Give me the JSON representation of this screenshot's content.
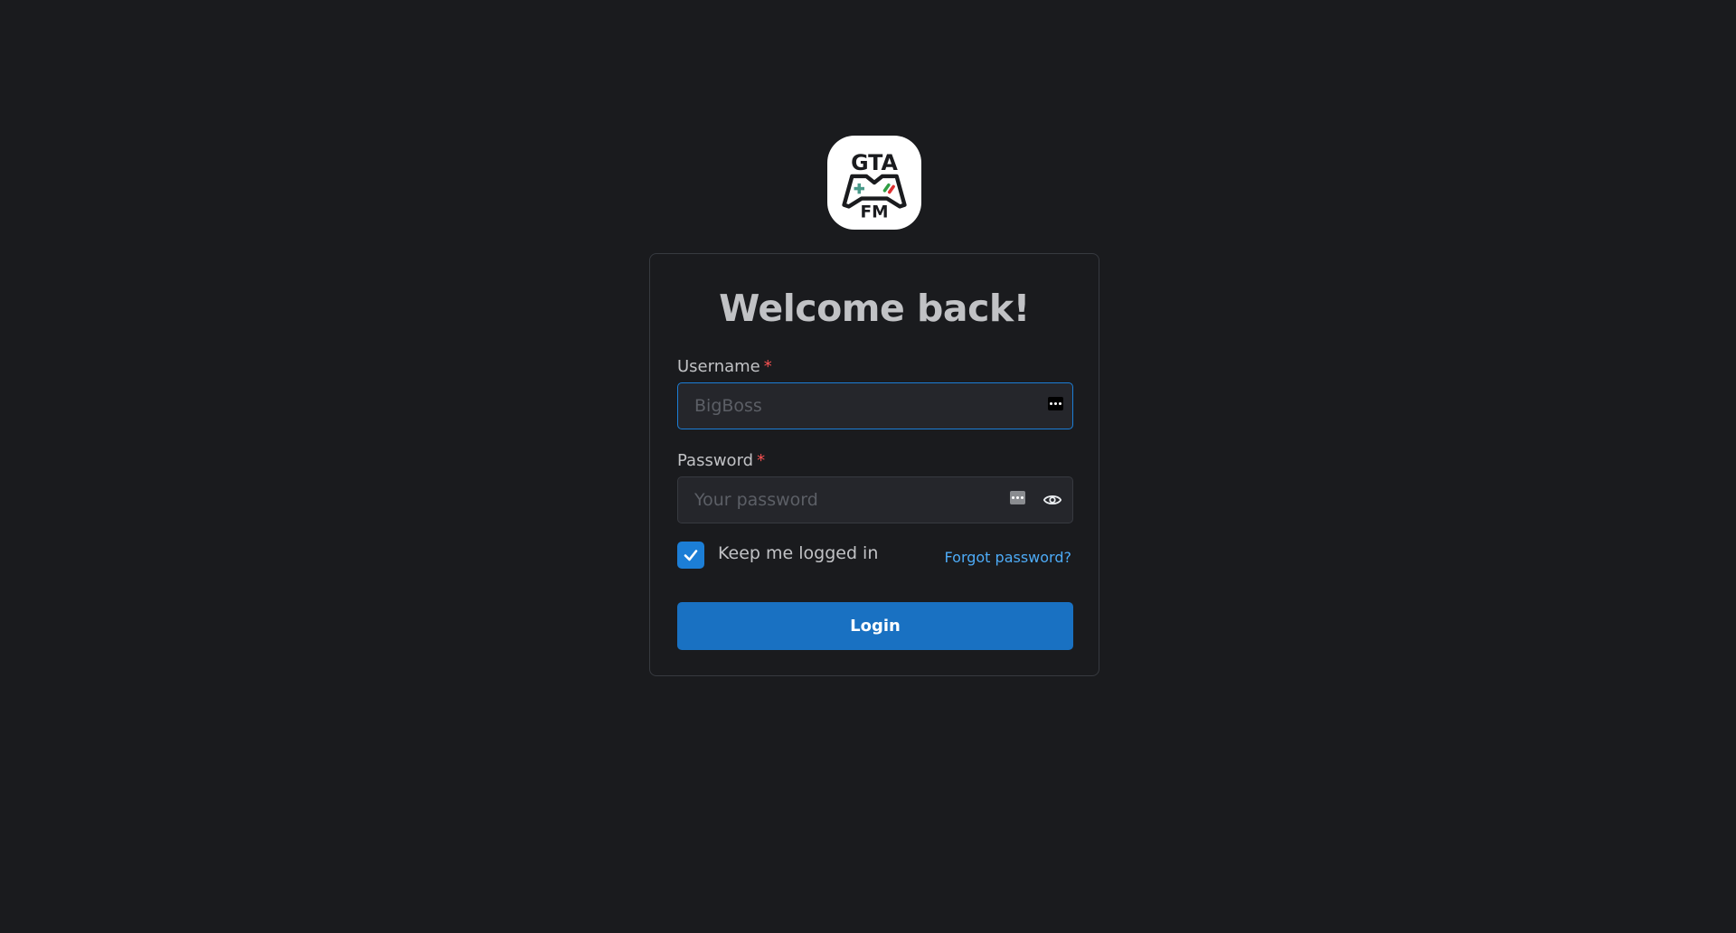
{
  "logo": {
    "top_text": "GTA",
    "bottom_text": "FM",
    "icon": "gamepad-logo-icon"
  },
  "login_form": {
    "title": "Welcome back!",
    "username": {
      "label": "Username",
      "required_mark": "*",
      "value": "",
      "placeholder": "BigBoss"
    },
    "password": {
      "label": "Password",
      "required_mark": "*",
      "value": "",
      "placeholder": "Your password",
      "toggle_icon": "eye-icon"
    },
    "remember": {
      "label": "Keep me logged in",
      "checked": true
    },
    "forgot_password": "Forgot password?",
    "submit_label": "Login"
  },
  "colors": {
    "background": "#1a1b1e",
    "input_background": "#25262b",
    "border": "#373a40",
    "primary": "#1971c2",
    "link": "#4dabf7",
    "required": "#fa5252",
    "text": "#c1c2c5"
  }
}
